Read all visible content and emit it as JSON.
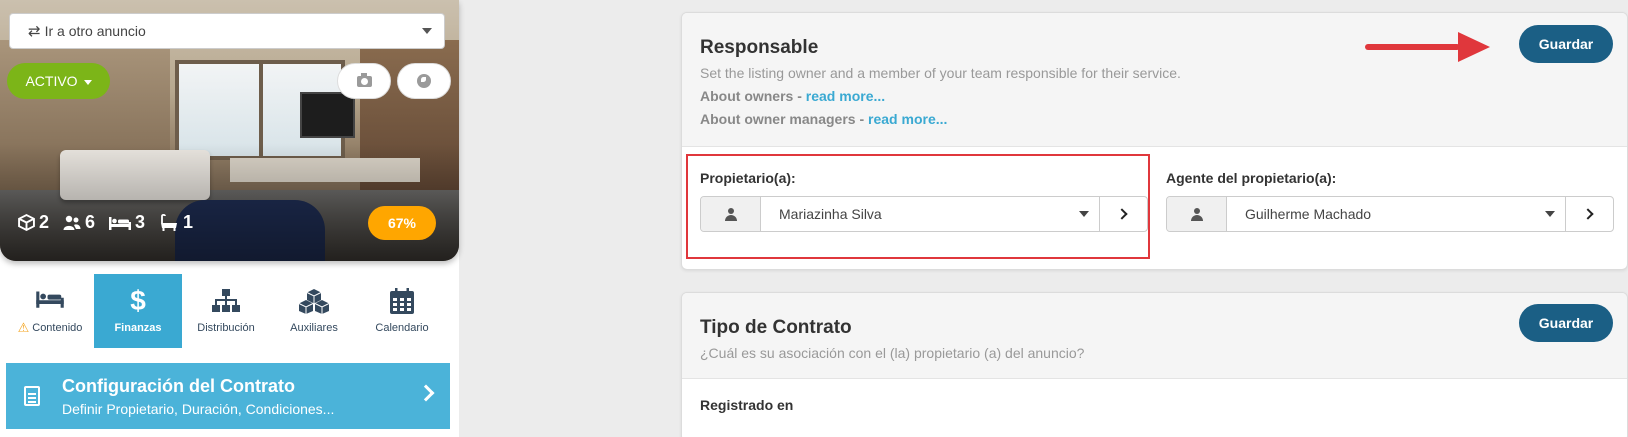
{
  "listing": {
    "goto_label": "Ir a otro anuncio",
    "status": "ACTIVO",
    "stats": {
      "rooms": "2",
      "guests": "6",
      "beds": "3",
      "baths": "1"
    },
    "completion": "67%"
  },
  "tabs": [
    {
      "label": "Contenido",
      "icon": "bed-icon",
      "warning": true
    },
    {
      "label": "Finanzas",
      "icon": "dollar-icon",
      "active": true
    },
    {
      "label": "Distribución",
      "icon": "sitemap-icon"
    },
    {
      "label": "Auxiliares",
      "icon": "cubes-icon"
    },
    {
      "label": "Calendario",
      "icon": "calendar-icon"
    }
  ],
  "contract": {
    "title": "Configuración del Contrato",
    "subtitle": "Definir Propietario, Duración, Condiciones..."
  },
  "responsable": {
    "title": "Responsable",
    "description": "Set the listing owner and a member of your team responsible for their service.",
    "owners_text": "About owners - ",
    "owners_link": "read more...",
    "managers_text": "About owner managers - ",
    "managers_link": "read more...",
    "save": "Guardar",
    "owner_label": "Propietario(a):",
    "owner_value": "Mariazinha Silva",
    "agent_label": "Agente del propietario(a):",
    "agent_value": "Guilherme Machado"
  },
  "contrato": {
    "title": "Tipo de Contrato",
    "description": "¿Cuál es su asociación con el (la) propietario (a) del anuncio?",
    "save": "Guardar",
    "registered_label": "Registrado en"
  },
  "colors": {
    "active_green": "#7cb518",
    "accent_blue": "#3aa9d2",
    "save_button": "#1b5f85",
    "completion_orange": "#ffa600",
    "highlight_red": "#e0373c"
  }
}
